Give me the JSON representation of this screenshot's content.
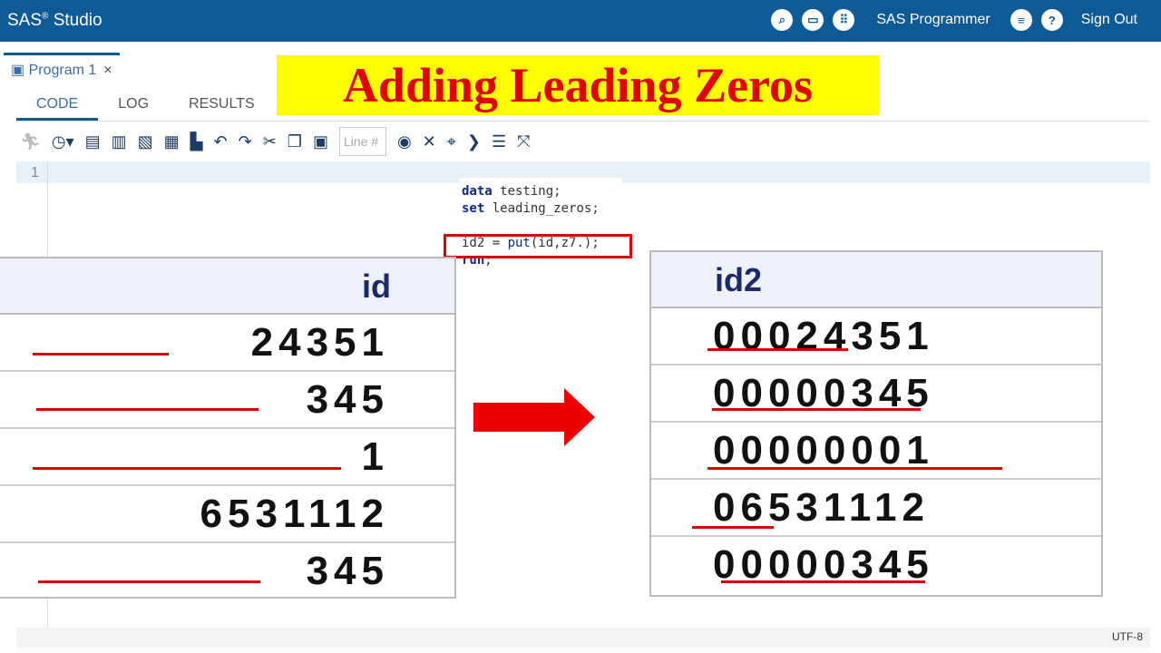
{
  "app": {
    "brand": "SAS",
    "brand_sup": "®",
    "brand_rest": "Studio",
    "user": "SAS Programmer",
    "sign_out": "Sign Out"
  },
  "tab": {
    "label": "Program 1",
    "close": "×"
  },
  "subtabs": [
    "CODE",
    "LOG",
    "RESULTS"
  ],
  "title": "Adding Leading Zeros",
  "toolbar": {
    "line_placeholder": "Line #"
  },
  "editor": {
    "line_number": "1"
  },
  "code": {
    "l1_kw": "data",
    "l1_rest": " testing;",
    "l2_kw": "set",
    "l2_rest": " leading_zeros;",
    "l3_a": "id2 = ",
    "l3_fn": "put",
    "l3_b": "(id,z7.);",
    "l4_kw": "run",
    "l4_rest": ";"
  },
  "table_left": {
    "header": "id",
    "rows": [
      "24351",
      "345",
      "1",
      "6531112",
      "345"
    ]
  },
  "table_right": {
    "header": "id2",
    "rows": [
      "00024351",
      "00000345",
      "00000001",
      "06531112",
      "00000345"
    ]
  },
  "status": {
    "encoding": "UTF-8"
  },
  "colors": {
    "topbar": "#0d5a97",
    "title_bg": "#ffff00",
    "title_fg": "#e00000",
    "highlight": "#dd0000"
  }
}
